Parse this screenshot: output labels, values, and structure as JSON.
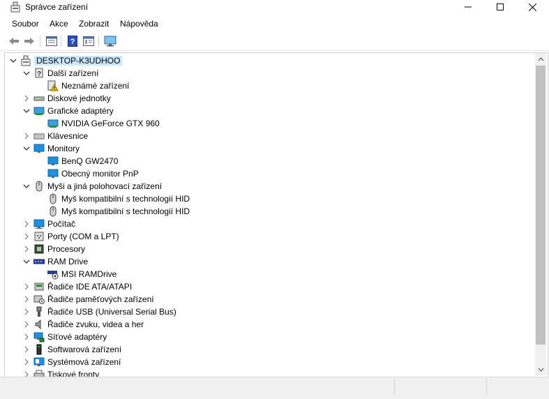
{
  "window": {
    "title": "Správce zařízení",
    "icon": "device-manager-icon"
  },
  "menu": [
    "Soubor",
    "Akce",
    "Zobrazit",
    "Nápověda"
  ],
  "toolbar": {
    "buttons": [
      "back-arrow-icon",
      "forward-arrow-icon",
      "properties-sheet-icon",
      "help-icon",
      "properties-view-icon",
      "monitor-scan-icon"
    ]
  },
  "tree": {
    "root": "DESKTOP-K3UDHOO",
    "nodes": [
      {
        "label": "Další zařízení",
        "state": "expanded",
        "icon": "other-devices-icon"
      },
      {
        "label": "Neznámé zařízení",
        "state": "leaf",
        "icon": "unknown-device-warning-icon"
      },
      {
        "label": "Diskové jednotky",
        "state": "collapsed",
        "icon": "disk-drive-icon"
      },
      {
        "label": "Grafické adaptéry",
        "state": "expanded",
        "icon": "display-adapter-icon"
      },
      {
        "label": "NVIDIA GeForce GTX 960",
        "state": "leaf",
        "icon": "display-adapter-icon"
      },
      {
        "label": "Klávesnice",
        "state": "collapsed",
        "icon": "keyboard-icon"
      },
      {
        "label": "Monitory",
        "state": "expanded",
        "icon": "monitor-icon"
      },
      {
        "label": "BenQ GW2470",
        "state": "leaf",
        "icon": "monitor-icon"
      },
      {
        "label": "Obecný monitor PnP",
        "state": "leaf",
        "icon": "monitor-icon"
      },
      {
        "label": "Myši a jiná polohovací zařízení",
        "state": "expanded",
        "icon": "mouse-icon"
      },
      {
        "label": "Myš kompatibilní s technologií HID",
        "state": "leaf",
        "icon": "mouse-icon"
      },
      {
        "label": "Myš kompatibilní s technologií HID",
        "state": "leaf",
        "icon": "mouse-icon"
      },
      {
        "label": "Počítač",
        "state": "collapsed",
        "icon": "computer-icon"
      },
      {
        "label": "Porty (COM a LPT)",
        "state": "collapsed",
        "icon": "port-icon"
      },
      {
        "label": "Procesory",
        "state": "collapsed",
        "icon": "processor-icon"
      },
      {
        "label": "RAM Drive",
        "state": "expanded",
        "icon": "ram-drive-icon"
      },
      {
        "label": "MSI RAMDrive",
        "state": "leaf",
        "icon": "ram-drive-settings-icon"
      },
      {
        "label": "Řadiče IDE ATA/ATAPI",
        "state": "collapsed",
        "icon": "ide-controller-icon"
      },
      {
        "label": "Řadiče paměťových zařízení",
        "state": "collapsed",
        "icon": "storage-controller-icon"
      },
      {
        "label": "Řadiče USB (Universal Serial Bus)",
        "state": "collapsed",
        "icon": "usb-icon"
      },
      {
        "label": "Řadiče zvuku, videa a her",
        "state": "collapsed",
        "icon": "speaker-icon"
      },
      {
        "label": "Síťové adaptéry",
        "state": "collapsed",
        "icon": "network-adapter-icon"
      },
      {
        "label": "Softwarová zařízení",
        "state": "collapsed",
        "icon": "software-device-icon"
      },
      {
        "label": "Systémová zařízení",
        "state": "collapsed",
        "icon": "system-device-icon"
      },
      {
        "label": "Tiskové fronty",
        "state": "collapsed",
        "icon": "printer-icon"
      }
    ]
  },
  "colors": {
    "selection": "#cce8ff",
    "monitor_blue": "#1e90e0",
    "warning_yellow": "#f5c400"
  }
}
